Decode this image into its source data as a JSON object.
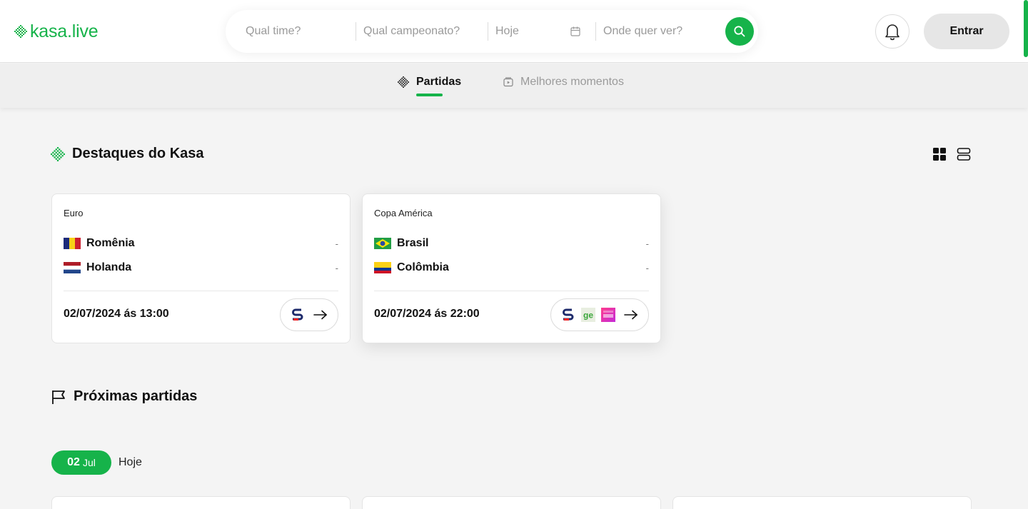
{
  "header": {
    "logo_text": "kasa.live",
    "search": {
      "team_placeholder": "Qual time?",
      "league_placeholder": "Qual campeonato?",
      "date_value": "Hoje",
      "where_placeholder": "Onde quer ver?"
    },
    "login_label": "Entrar",
    "accent_color": "#16b34a"
  },
  "tabs": [
    {
      "label": "Partidas",
      "active": true
    },
    {
      "label": "Melhores momentos",
      "active": false
    }
  ],
  "highlights": {
    "title": "Destaques do Kasa",
    "cards": [
      {
        "league": "Euro",
        "home": {
          "name": "Romênia",
          "score": "-"
        },
        "away": {
          "name": "Holanda",
          "score": "-"
        },
        "datetime": "02/07/2024 ás 13:00",
        "broadcasters": [
          "sportv"
        ]
      },
      {
        "league": "Copa América",
        "home": {
          "name": "Brasil",
          "score": "-"
        },
        "away": {
          "name": "Colômbia",
          "score": "-"
        },
        "datetime": "02/07/2024 ás 22:00",
        "broadcasters": [
          "sportv",
          "ge",
          "globo"
        ]
      }
    ]
  },
  "upcoming": {
    "title": "Próximas partidas",
    "date_day": "02",
    "date_month": "Jul",
    "date_label": "Hoje"
  },
  "icons": {
    "logo": "kasa-logo-icon",
    "calendar": "calendar-icon",
    "search": "search-icon",
    "bell": "bell-icon",
    "grid_view": "grid-view-icon",
    "list_view": "list-view-icon",
    "flag": "flag-icon",
    "arrow": "arrow-right-icon"
  }
}
